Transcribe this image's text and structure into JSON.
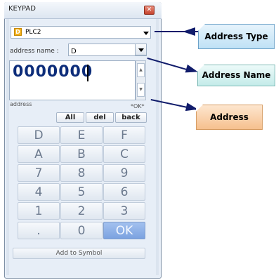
{
  "window": {
    "title": "KEYPAD"
  },
  "address_type": {
    "badge": "D",
    "value": "PLC2"
  },
  "address_name": {
    "label": "address name :",
    "value": "D"
  },
  "display": {
    "value": "0000000"
  },
  "address_row": {
    "label": "address",
    "status": "*OK*"
  },
  "actions": {
    "all": "All",
    "del": "del",
    "back": "back"
  },
  "keypad": {
    "rows": [
      [
        "D",
        "E",
        "F"
      ],
      [
        "A",
        "B",
        "C"
      ],
      [
        "7",
        "8",
        "9"
      ],
      [
        "4",
        "5",
        "6"
      ],
      [
        "1",
        "2",
        "3"
      ],
      [
        ".",
        "0",
        "OK"
      ]
    ]
  },
  "add_to_symbol": "Add to Symbol",
  "callouts": {
    "address_type": "Address Type",
    "address_name": "Address Name",
    "address": "Address"
  },
  "colors": {
    "digits": "#0d2d7a",
    "ok_key": "#7ba2e0",
    "callout_line": "#111c6b",
    "address_callout": "#f6c08e"
  }
}
